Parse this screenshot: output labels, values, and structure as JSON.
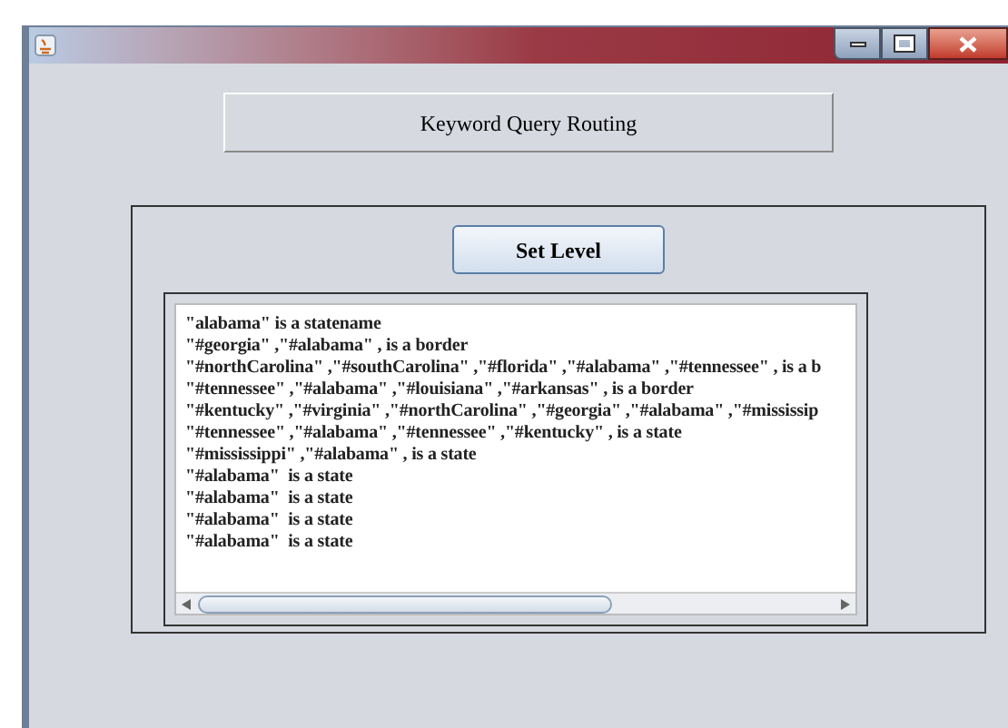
{
  "header": {
    "label": "Keyword Query Routing"
  },
  "panel": {
    "button": "Set Level",
    "output_lines": [
      "\"alabama\" is a statename",
      "\"#georgia\" ,\"#alabama\" , is a border",
      "\"#northCarolina\" ,\"#southCarolina\" ,\"#florida\" ,\"#alabama\" ,\"#tennessee\" , is a b",
      "\"#tennessee\" ,\"#alabama\" ,\"#louisiana\" ,\"#arkansas\" , is a border",
      "\"#kentucky\" ,\"#virginia\" ,\"#northCarolina\" ,\"#georgia\" ,\"#alabama\" ,\"#mississip",
      "\"#tennessee\" ,\"#alabama\" ,\"#tennessee\" ,\"#kentucky\" , is a state",
      "\"#mississippi\" ,\"#alabama\" , is a state",
      "\"#alabama\"  is a state",
      "\"#alabama\"  is a state",
      "\"#alabama\"  is a state",
      "\"#alabama\"  is a state"
    ]
  }
}
